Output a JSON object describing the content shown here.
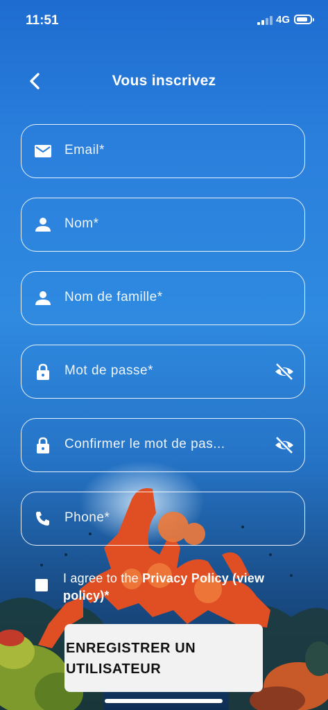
{
  "status_bar": {
    "time": "11:51",
    "network": "4G"
  },
  "header": {
    "title": "Vous inscrivez"
  },
  "fields": [
    {
      "icon": "mail-icon",
      "placeholder": "Email*"
    },
    {
      "icon": "person-icon",
      "placeholder": "Nom*"
    },
    {
      "icon": "person-icon",
      "placeholder": "Nom de famille*"
    },
    {
      "icon": "lock-icon",
      "placeholder": "Mot de passe*",
      "toggle": "visibility-off-icon"
    },
    {
      "icon": "lock-icon",
      "placeholder": "Confirmer le mot de pas...",
      "toggle": "visibility-off-icon"
    },
    {
      "icon": "phone-icon",
      "placeholder": "Phone*"
    }
  ],
  "consent": {
    "prefix": "I agree to the ",
    "link": "Privacy Policy",
    "link2": "(view policy)*",
    "checked": false
  },
  "register_button": {
    "line1": "ENREGISTRER UN",
    "line2": "UTILISATEUR"
  },
  "colors": {
    "bg_top": "#1e6cd0",
    "bg_bottom": "#0f2f55",
    "coral": "#e85a2a",
    "button_bg": "#f2f2f2"
  }
}
